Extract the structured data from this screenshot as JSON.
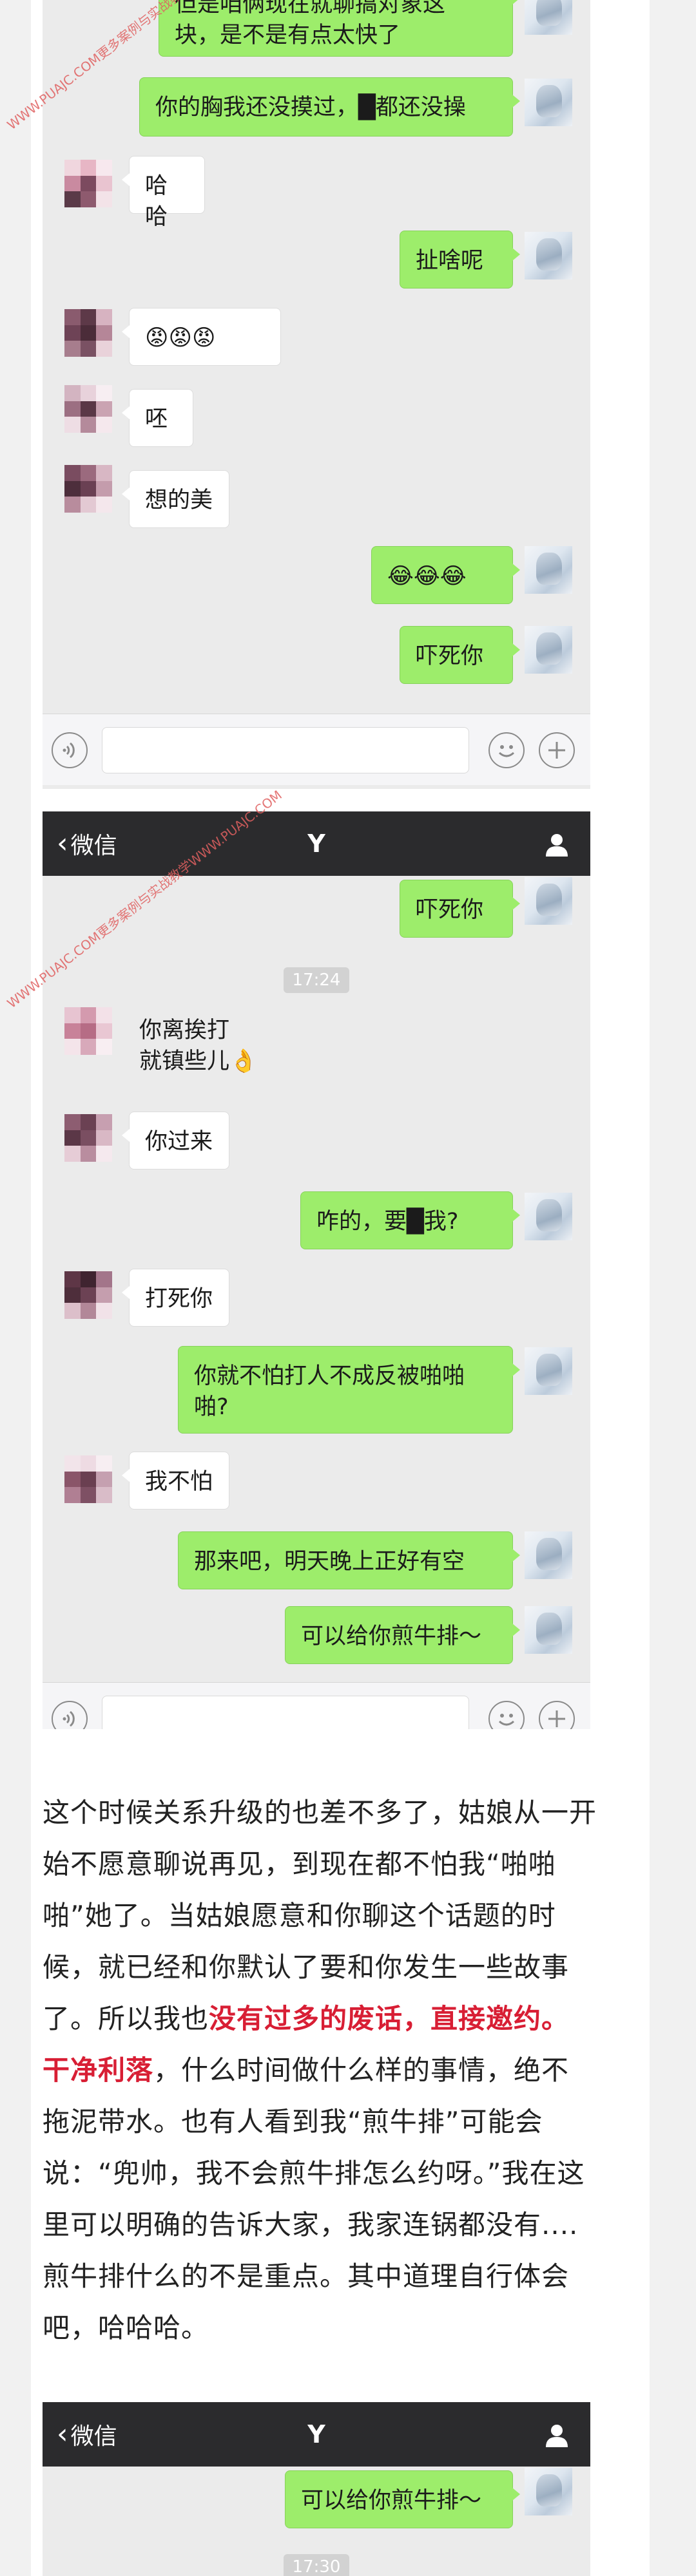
{
  "shot1": {
    "messages": [
      {
        "side": "out",
        "text": "但是咱俩现在就聊搞对象这\n块，是不是有点太快了"
      },
      {
        "side": "out",
        "text": "你的胸我还没摸过，█都还没操"
      },
      {
        "side": "in",
        "text": "哈哈"
      },
      {
        "side": "out",
        "text": "扯啥呢"
      },
      {
        "side": "in",
        "text": "😡😡😡"
      },
      {
        "side": "in",
        "text": "呸"
      },
      {
        "side": "in",
        "text": "想的美"
      },
      {
        "side": "out",
        "text": "😂😂😂"
      },
      {
        "side": "out",
        "text": "吓死你"
      }
    ]
  },
  "shot2": {
    "nav": {
      "back_label": "微信",
      "title": "Y"
    },
    "timestamp": "17:24",
    "messages": [
      {
        "side": "out",
        "text": "吓死你"
      },
      {
        "side": "in",
        "text": "你离挨打\n就镇些儿👌"
      },
      {
        "side": "in",
        "text": "你过来"
      },
      {
        "side": "out",
        "text": "咋的，要█我?"
      },
      {
        "side": "in",
        "text": "打死你"
      },
      {
        "side": "out",
        "text": "你就不怕打人不成反被啪啪\n啪?"
      },
      {
        "side": "in",
        "text": "我不怕"
      },
      {
        "side": "out",
        "text": "那来吧，明天晚上正好有空"
      },
      {
        "side": "out",
        "text": "可以给你煎牛排～"
      }
    ]
  },
  "article": {
    "p1": "这个时候关系升级的也差不多了，姑娘从一开始不愿意聊说再见，到现在都不怕我“啪啪啪”她了。当姑娘愿意和你聊这个话题的时候，就已经和你默认了要和你发生一些故事了。所以我也",
    "highlight": "没有过多的废话，直接邀约。干净利落",
    "p2": "，什么时间做什么样的事情，绝不拖泥带水。也有人看到我“煎牛排”可能会说：“兜帅，我不会煎牛排怎么约呀。”我在这里可以明确的告诉大家，我家连锅都没有....煎牛排什么的不是重点。其中道理自行体会吧，哈哈哈。"
  },
  "shot3": {
    "nav": {
      "back_label": "微信",
      "title": "Y"
    },
    "messages": [
      {
        "side": "out",
        "text": "可以给你煎牛排～"
      }
    ],
    "timestamp": "17:30"
  },
  "watermarks": {
    "w1": "WWW.PUAJC.COM更多案例与实战教学",
    "w2": "WWW.PUAJC.COM更多案例与实战教学WWW.PUAJC.COM"
  },
  "colors": {
    "out_bubble": "#9ded6b",
    "in_bubble": "#ffffff",
    "chat_bg": "#ebebeb",
    "navbar": "#2b2b2d",
    "highlight": "#d81e34"
  }
}
